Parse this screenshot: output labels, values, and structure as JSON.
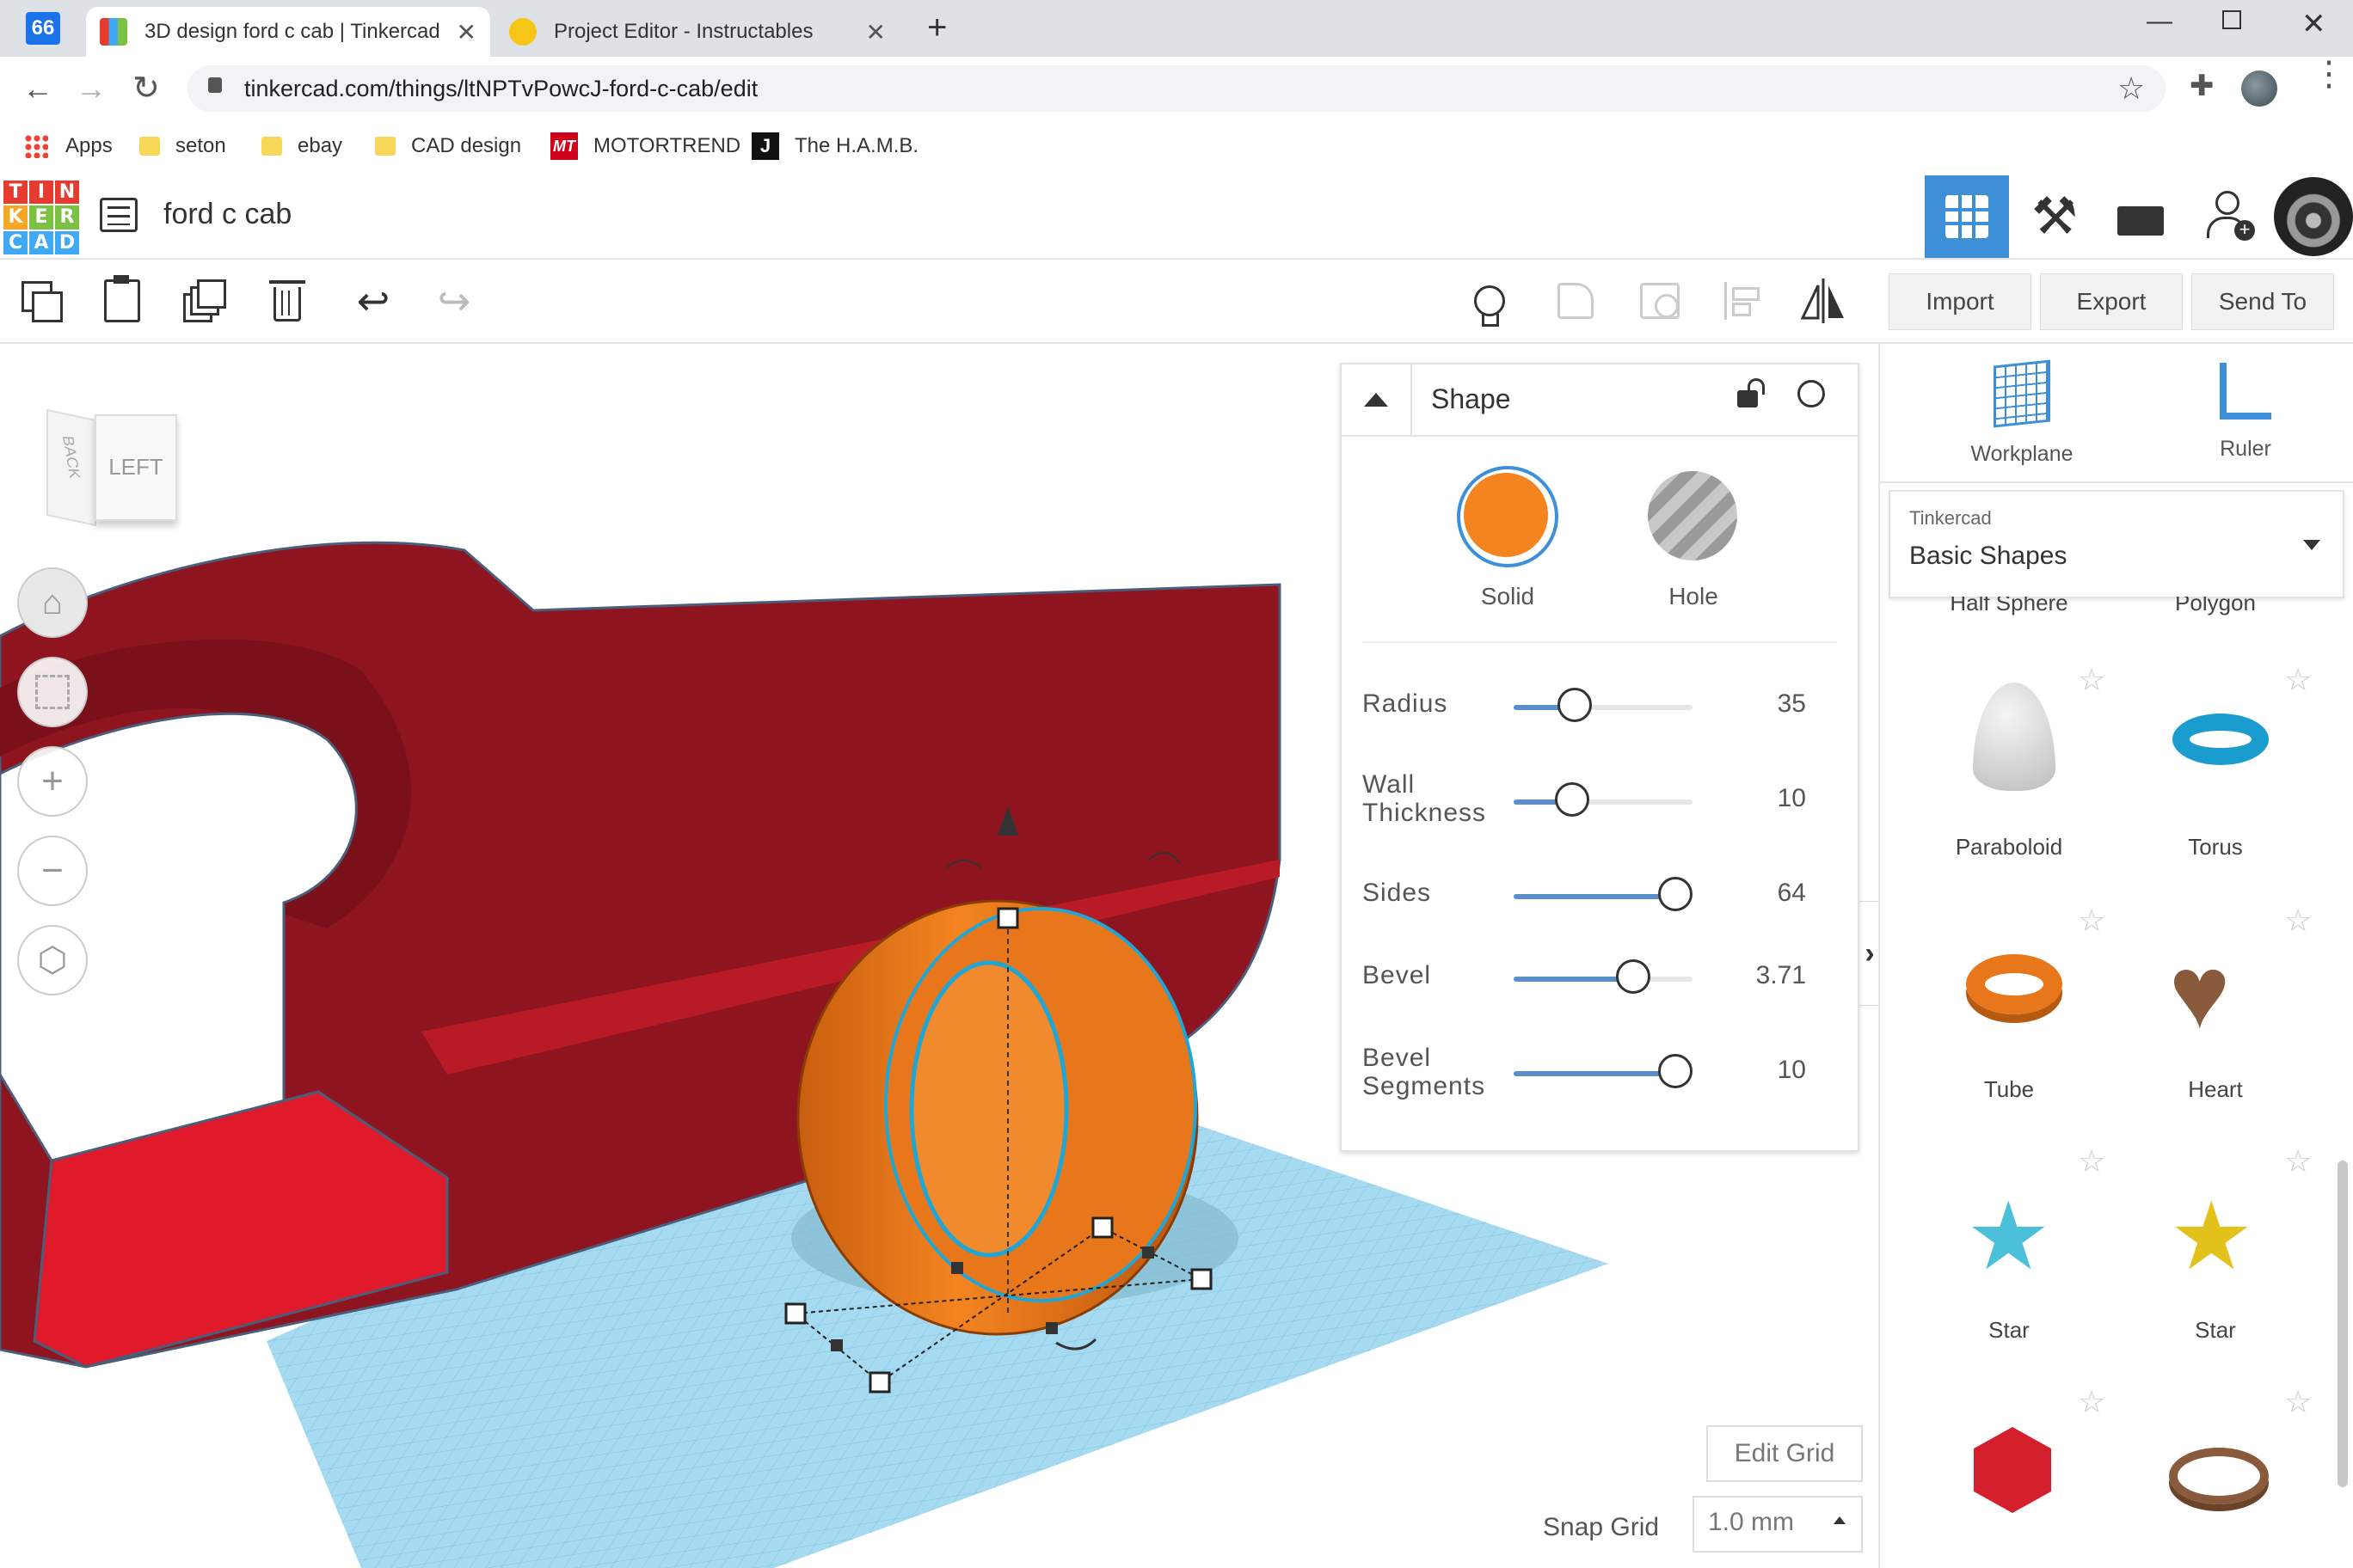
{
  "browser": {
    "tabs": [
      {
        "title": "3D design ford c cab | Tinkercad",
        "active": true
      },
      {
        "title": "Project Editor - Instructables",
        "active": false
      }
    ],
    "url": "tinkercad.com/things/ltNPTvPowcJ-ford-c-cab/edit",
    "bookmarks": [
      "Apps",
      "seton",
      "ebay",
      "CAD design",
      "MOTORTREND",
      "The H.A.M.B."
    ],
    "motortrend_badge": "MT",
    "hamb_badge": "J",
    "ext_badge": "66"
  },
  "app": {
    "logo_letters": [
      "T",
      "I",
      "N",
      "K",
      "E",
      "R",
      "C",
      "A",
      "D"
    ],
    "design_title": "ford c cab",
    "colors": {
      "accent": "#3d8fd8",
      "solid": "#f48420",
      "model": "#8e1520",
      "workplane": "#a6daf1"
    }
  },
  "toolbar": {
    "import_label": "Import",
    "export_label": "Export",
    "send_label": "Send To"
  },
  "viewcube": {
    "face_left": "LEFT",
    "face_back": "BACK"
  },
  "inspector": {
    "title": "Shape",
    "solid_label": "Solid",
    "hole_label": "Hole",
    "params": [
      {
        "label": [
          "Radius"
        ],
        "value": "35",
        "fill": 0.38
      },
      {
        "label": [
          "Wall",
          "Thickness"
        ],
        "value": "10",
        "fill": 0.36
      },
      {
        "label": [
          "Sides"
        ],
        "value": "64",
        "fill": 1.0
      },
      {
        "label": [
          "Bevel"
        ],
        "value": "3.71",
        "fill": 0.74
      },
      {
        "label": [
          "Bevel",
          "Segments"
        ],
        "value": "10",
        "fill": 1.0
      }
    ]
  },
  "right_panel": {
    "workplane_label": "Workplane",
    "ruler_label": "Ruler",
    "library_source": "Tinkercad",
    "library_name": "Basic Shapes",
    "partial_shapes": [
      "Half Sphere",
      "Polygon"
    ],
    "shapes": [
      "Paraboloid",
      "Torus",
      "Tube",
      "Heart",
      "Star",
      "Star"
    ]
  },
  "grid": {
    "edit_grid_label": "Edit Grid",
    "snap_label": "Snap Grid",
    "snap_value": "1.0 mm"
  }
}
